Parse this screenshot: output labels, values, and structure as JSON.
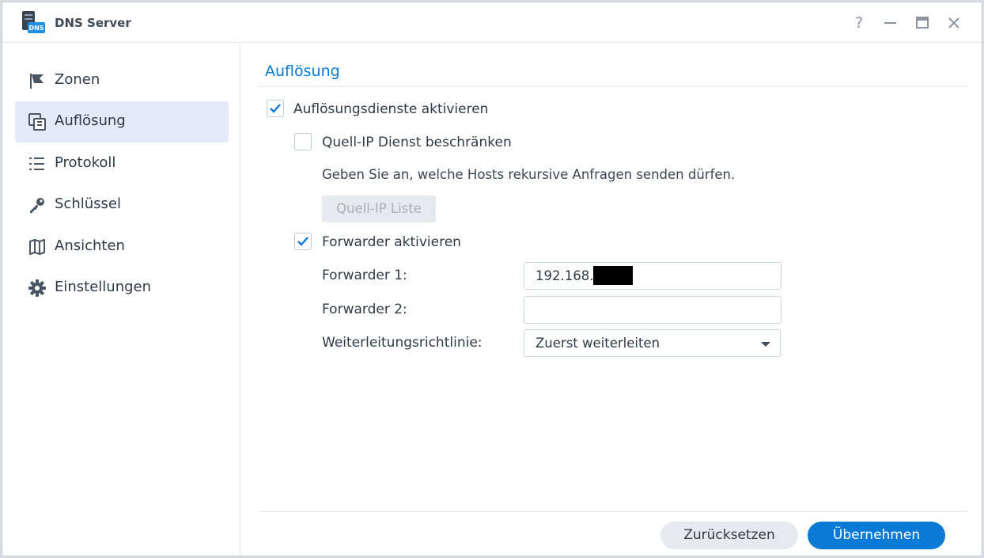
{
  "window": {
    "title": "DNS Server",
    "app_icon_badge": "DNS",
    "controls": {
      "help": "?",
      "minimize": "–",
      "maximize": "□",
      "close": "✕"
    }
  },
  "sidebar": {
    "items": [
      {
        "label": "Zonen",
        "icon": "flag-icon",
        "active": false
      },
      {
        "label": "Auflösung",
        "icon": "resolution-icon",
        "active": true
      },
      {
        "label": "Protokoll",
        "icon": "list-icon",
        "active": false
      },
      {
        "label": "Schlüssel",
        "icon": "key-icon",
        "active": false
      },
      {
        "label": "Ansichten",
        "icon": "map-icon",
        "active": false
      },
      {
        "label": "Einstellungen",
        "icon": "gear-icon",
        "active": false
      }
    ]
  },
  "main": {
    "section_title": "Auflösung",
    "enable_resolution": {
      "label": "Auflösungsdienste aktivieren",
      "checked": true
    },
    "limit_source_ip": {
      "label": "Quell-IP Dienst beschränken",
      "checked": false
    },
    "hint": "Geben Sie an, welche Hosts rekursive Anfragen senden dürfen.",
    "source_ip_list_button": "Quell-IP Liste",
    "enable_forwarder": {
      "label": "Forwarder aktivieren",
      "checked": true
    },
    "forwarder1": {
      "label": "Forwarder 1:",
      "value": "192.168."
    },
    "forwarder2": {
      "label": "Forwarder 2:",
      "value": ""
    },
    "policy": {
      "label": "Weiterleitungsrichtlinie:",
      "value": "Zuerst weiterleiten"
    }
  },
  "footer": {
    "reset_label": "Zurücksetzen",
    "apply_label": "Übernehmen"
  },
  "colors": {
    "accent": "#0a7ad6",
    "active_bg": "#e2ecf8",
    "text": "#2f3a46"
  }
}
